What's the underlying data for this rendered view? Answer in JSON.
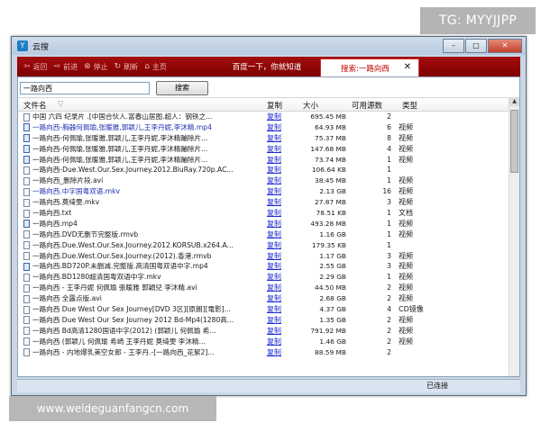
{
  "watermark_top": "TG: MYYJJPP",
  "watermark_bottom": "www.weideguanfangcn.com",
  "window": {
    "title": "云搜",
    "app_icon": "Y"
  },
  "toolbar": {
    "back": "返回",
    "forward": "前进",
    "stop": "停止",
    "refresh": "刷新",
    "home": "主页",
    "tab_baidu": "百度一下，你就知道",
    "tab_search": "搜索:一路向西",
    "accent_color": "#8b0000"
  },
  "search": {
    "value": "一路向西",
    "button": "搜索"
  },
  "columns": {
    "name": "文件名",
    "copy": "复制",
    "size": "大小",
    "sources": "可用源数",
    "type": "类型"
  },
  "rows": [
    {
      "icon": "file-icon",
      "name": "中国 六四 纪录片 .[中国合伙人.富春山居图.超人：钢铁之...",
      "copy": "复制",
      "size": "695.45 MB",
      "sources": "2",
      "type": ""
    },
    {
      "icon": "rmvb-file-icon",
      "name": "一路向西-胸器何佩瑜,张暖雅,郭颖儿,王李丹妮,李沐精.mp4",
      "copy": "复制",
      "size": "64.93 MB",
      "sources": "6",
      "type": "视频",
      "hl": true
    },
    {
      "icon": "rmvb-file-icon",
      "name": "一路向西-何佩瑜,张暖雅,郭颖儿,王李丹妮,李沐精蹦除片...",
      "copy": "复制",
      "size": "75.37 MB",
      "sources": "8",
      "type": "视频"
    },
    {
      "icon": "rmvb-file-icon",
      "name": "一路向西-何佩瑜,张暖雅,郭颖儿,王李丹妮,李沐精蹦除片...",
      "copy": "复制",
      "size": "147.68 MB",
      "sources": "4",
      "type": "视频"
    },
    {
      "icon": "rmvb-file-icon",
      "name": "一路向西-何佩瑜,张暖雅,郭颖儿,王李丹妮,李沐精蹦除片...",
      "copy": "复制",
      "size": "73.74 MB",
      "sources": "1",
      "type": "视频"
    },
    {
      "icon": "file-icon",
      "name": "一路向西-Due.West.Our.Sex.Journey.2012.BluRay.720p.AC...",
      "copy": "复制",
      "size": "106.64 KB",
      "sources": "1",
      "type": ""
    },
    {
      "icon": "file-icon",
      "name": "一路向西_删除片段.avi",
      "copy": "复制",
      "size": "38.45 MB",
      "sources": "1",
      "type": "视频"
    },
    {
      "icon": "file-icon",
      "name": "一路向西.中字国粤双语.mkv",
      "copy": "复制",
      "size": "2.13 GB",
      "sources": "16",
      "type": "视频",
      "hl": true
    },
    {
      "icon": "file-icon",
      "name": "一路向西.莫绮雯.mkv",
      "copy": "复制",
      "size": "27.87 MB",
      "sources": "3",
      "type": "视频"
    },
    {
      "icon": "file-icon",
      "name": "一路向西.txt",
      "copy": "复制",
      "size": "78.51 KB",
      "sources": "1",
      "type": "文档"
    },
    {
      "icon": "rmvb-file-icon",
      "name": "一路向西.mp4",
      "copy": "复制",
      "size": "493.28 MB",
      "sources": "1",
      "type": "视频"
    },
    {
      "icon": "file-icon",
      "name": "一路向西.DVD无删节完整版.rmvb",
      "copy": "复制",
      "size": "1.16 GB",
      "sources": "1",
      "type": "视频"
    },
    {
      "icon": "file-icon",
      "name": "一路向西.Due.West.Our.Sex.Journey.2012.KORSUB.x264.A...",
      "copy": "复制",
      "size": "179.35 KB",
      "sources": "1",
      "type": ""
    },
    {
      "icon": "file-icon",
      "name": "一路向西.Due.West.Our.Sex.Journey.(2012).香港.rmvb",
      "copy": "复制",
      "size": "1.17 GB",
      "sources": "3",
      "type": "视频"
    },
    {
      "icon": "rmvb-file-icon",
      "name": "一路向西.BD720P.未删减.完整版.高清国粤双语中字.mp4",
      "copy": "复制",
      "size": "2.55 GB",
      "sources": "3",
      "type": "视频"
    },
    {
      "icon": "file-icon",
      "name": "一路向西.BD1280超清国粤双语中字.mkv",
      "copy": "复制",
      "size": "2.29 GB",
      "sources": "1",
      "type": "视频"
    },
    {
      "icon": "file-icon",
      "name": "一路向西 - 王李丹妮 何佩瑜 張暖雅 郭穎兒 李沐精.avi",
      "copy": "复制",
      "size": "44.50 MB",
      "sources": "2",
      "type": "视频"
    },
    {
      "icon": "file-icon",
      "name": "一路向西 全露点版.avi",
      "copy": "复制",
      "size": "2.68 GB",
      "sources": "2",
      "type": "视频"
    },
    {
      "icon": "file-icon",
      "name": "一路向西 Due West Our Sex Journey[DVD 3区][原朗][電影]...",
      "copy": "复制",
      "size": "4.37 GB",
      "sources": "4",
      "type": "CD镜像"
    },
    {
      "icon": "file-icon",
      "name": "一路向西 Due West Our Sex Journey 2012 Bd-Mp4(1280高...",
      "copy": "复制",
      "size": "1.35 GB",
      "sources": "2",
      "type": "视频"
    },
    {
      "icon": "file-icon",
      "name": "一路向西 Bd高清1280国语中字(2012) (郭颖儿 何佩瑜 希...",
      "copy": "复制",
      "size": "791.92 MB",
      "sources": "2",
      "type": "视频"
    },
    {
      "icon": "file-icon",
      "name": "一路向西 (郭颖儿 何佩瑜 希崎 王李丹妮 莫绮雯 李沐精...",
      "copy": "复制",
      "size": "1.46 GB",
      "sources": "2",
      "type": "视频"
    },
    {
      "icon": "file-icon",
      "name": "一路向西 - 内地爆乳美空女郎 - 王李丹.-[一路向西_花絮2]...",
      "copy": "复制",
      "size": "88.59 MB",
      "sources": "2",
      "type": ""
    }
  ],
  "status": {
    "text": "已连接"
  }
}
